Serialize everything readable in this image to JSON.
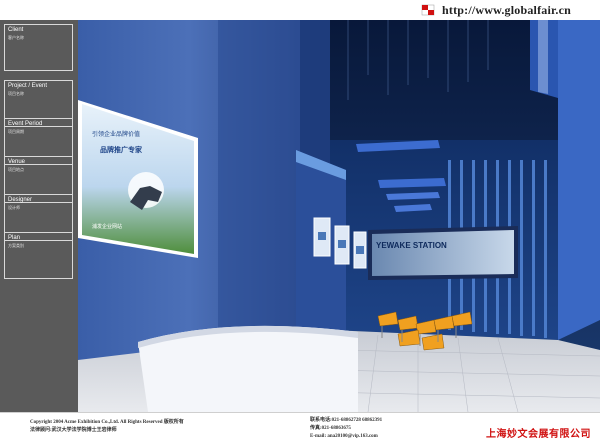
{
  "header": {
    "url": "http://www.globalfair.cn",
    "logo_icon": "flag-logo-icon"
  },
  "sidebar": {
    "items": [
      {
        "label": "Client",
        "sub": "客户名称"
      },
      {
        "label": "Project / Event",
        "sub": "项目名称"
      },
      {
        "label": "Event Period",
        "sub": "项目周期"
      },
      {
        "label": "Venue",
        "sub": "项目地点"
      },
      {
        "label": "Designer",
        "sub": "设计师"
      },
      {
        "label": "Plan",
        "sub": "方案类别"
      }
    ]
  },
  "render": {
    "left_poster": {
      "title": "引领企业品牌价值",
      "subtitle": "品牌推广专家",
      "brand": "浦发企业网站"
    },
    "right_banner": {
      "text": "YEWAKE STATION"
    }
  },
  "footer": {
    "copyright": "Copyright 2004 Acme Exhibition Co.,Ltd. All Rights Reserved 版权所有",
    "lawyer": "法律顾问:武汉大学法学院博士王岩律师",
    "contact_phone": "联系电话:021-68862728 68862391",
    "contact_fax": "传真:021-68863675",
    "contact_email": "E-mail: ana20100@vip.163.com",
    "company": "上海妙文会展有限公司"
  },
  "colors": {
    "brand_red": "#d01010",
    "sidebar_bg": "#5a5a5a",
    "booth_blue": "#2a4a8c",
    "chair_orange": "#f0a020"
  }
}
